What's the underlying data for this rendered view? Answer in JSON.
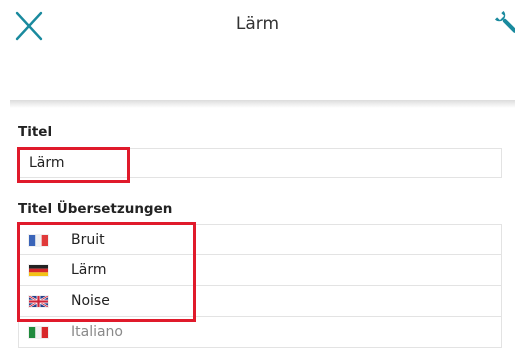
{
  "header": {
    "title": "Lärm",
    "close_icon": "close-icon",
    "wrench_icon": "wrench-icon",
    "accent_color": "#1a8a9e"
  },
  "title_section": {
    "label": "Titel",
    "value": "Lärm"
  },
  "translations_section": {
    "label": "Titel Übersetzungen",
    "rows": [
      {
        "flag": "flag-fr-icon",
        "text": "Bruit"
      },
      {
        "flag": "flag-de-icon",
        "text": "Lärm"
      },
      {
        "flag": "flag-gb-icon",
        "text": "Noise"
      },
      {
        "flag": "flag-it-icon",
        "placeholder": "Italiano"
      }
    ]
  },
  "highlight_color": "#e01a2b"
}
